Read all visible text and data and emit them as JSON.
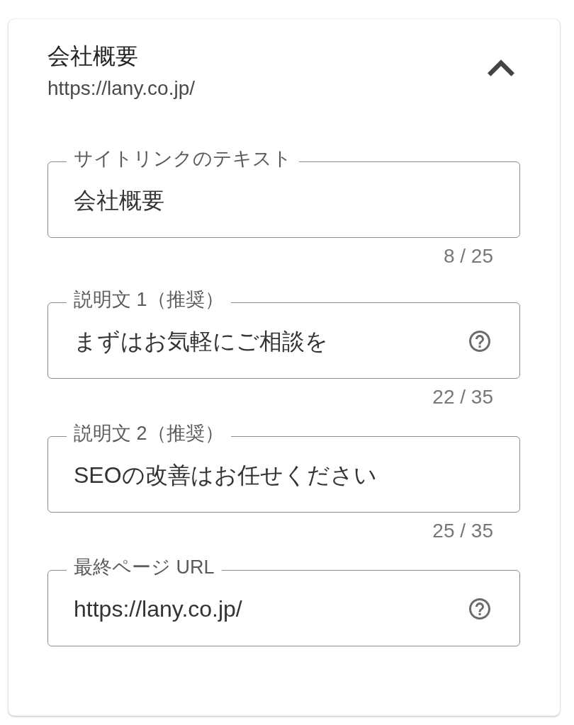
{
  "section": {
    "title": "会社概要",
    "url": "https://lany.co.jp/",
    "expanded": true
  },
  "fields": [
    {
      "label": "サイトリンクのテキスト",
      "value": "会社概要",
      "counter": "8 / 25",
      "help_icon": false
    },
    {
      "label": "説明文 1（推奨）",
      "value": "まずはお気軽にご相談を",
      "counter": "22 / 35",
      "help_icon": true
    },
    {
      "label": "説明文 2（推奨）",
      "value": "SEOの改善はお任せください",
      "counter": "25 / 35",
      "help_icon": false
    },
    {
      "label": "最終ページ URL",
      "value": "https://lany.co.jp/",
      "help_icon": true
    }
  ]
}
